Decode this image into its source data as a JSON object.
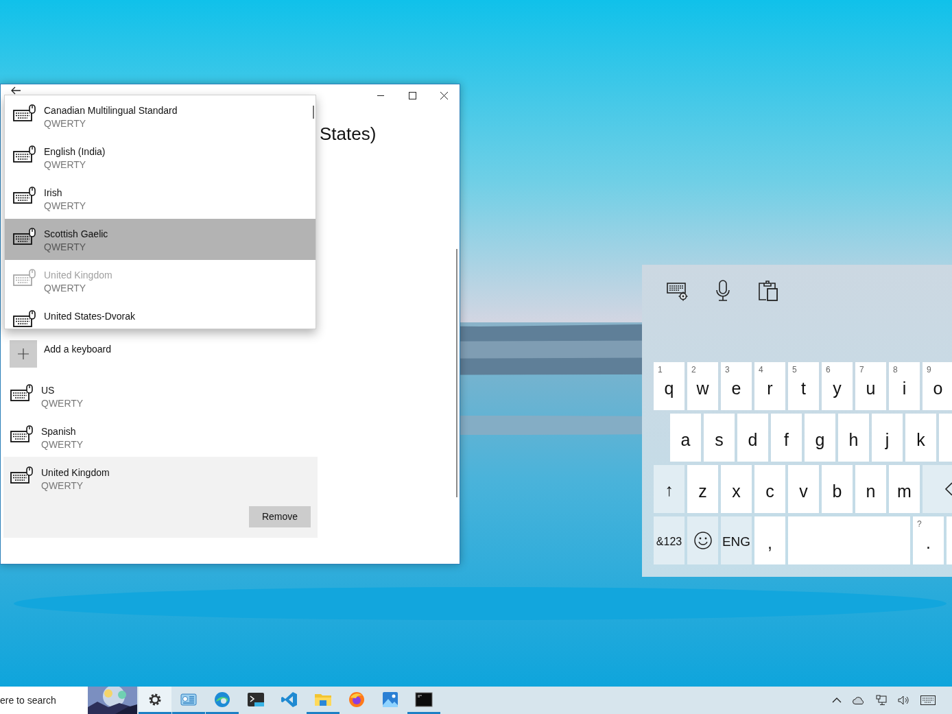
{
  "settings_window": {
    "heading": "States)",
    "dropdown": {
      "items": [
        {
          "name": "Canadian Multilingual Standard",
          "layout": "QWERTY",
          "selected": false,
          "disabled": false
        },
        {
          "name": "English (India)",
          "layout": "QWERTY",
          "selected": false,
          "disabled": false
        },
        {
          "name": "Irish",
          "layout": "QWERTY",
          "selected": false,
          "disabled": false
        },
        {
          "name": "Scottish Gaelic",
          "layout": "QWERTY",
          "selected": true,
          "disabled": false
        },
        {
          "name": "United Kingdom",
          "layout": "QWERTY",
          "selected": false,
          "disabled": true
        },
        {
          "name": "United States-Dvorak",
          "selected": false,
          "disabled": false
        }
      ]
    },
    "add_keyboard": "Add a keyboard",
    "keyboards": [
      {
        "name": "US",
        "layout": "QWERTY",
        "selected": false
      },
      {
        "name": "Spanish",
        "layout": "QWERTY",
        "selected": false
      },
      {
        "name": "United Kingdom",
        "layout": "QWERTY",
        "selected": true
      }
    ],
    "remove_button": "Remove"
  },
  "touch_keyboard": {
    "rows": [
      [
        {
          "kind": "letter",
          "label": "q",
          "hint": "1"
        },
        {
          "kind": "letter",
          "label": "w",
          "hint": "2"
        },
        {
          "kind": "letter",
          "label": "e",
          "hint": "3"
        },
        {
          "kind": "letter",
          "label": "r",
          "hint": "4"
        },
        {
          "kind": "letter",
          "label": "t",
          "hint": "5"
        },
        {
          "kind": "letter",
          "label": "y",
          "hint": "6"
        },
        {
          "kind": "letter",
          "label": "u",
          "hint": "7"
        },
        {
          "kind": "letter",
          "label": "i",
          "hint": "8"
        },
        {
          "kind": "letter",
          "label": "o",
          "hint": "9"
        }
      ],
      [
        {
          "kind": "letter",
          "label": "a"
        },
        {
          "kind": "letter",
          "label": "s"
        },
        {
          "kind": "letter",
          "label": "d"
        },
        {
          "kind": "letter",
          "label": "f"
        },
        {
          "kind": "letter",
          "label": "g"
        },
        {
          "kind": "letter",
          "label": "h"
        },
        {
          "kind": "letter",
          "label": "j"
        },
        {
          "kind": "letter",
          "label": "k"
        },
        {
          "kind": "letter"
        }
      ],
      [
        {
          "kind": "shift",
          "label": "↑"
        },
        {
          "kind": "letter",
          "label": "z"
        },
        {
          "kind": "letter",
          "label": "x"
        },
        {
          "kind": "letter",
          "label": "c"
        },
        {
          "kind": "letter",
          "label": "v"
        },
        {
          "kind": "letter",
          "label": "b"
        },
        {
          "kind": "letter",
          "label": "n"
        },
        {
          "kind": "letter",
          "label": "m"
        },
        {
          "kind": "backspace"
        }
      ],
      [
        {
          "kind": "symbols",
          "label": "&123"
        },
        {
          "kind": "emoji"
        },
        {
          "kind": "language",
          "label": "ENG"
        },
        {
          "kind": "letter",
          "label": ","
        },
        {
          "kind": "space"
        },
        {
          "kind": "letter",
          "label": ".",
          "hint": "?"
        },
        {
          "kind": "letter"
        }
      ]
    ]
  },
  "taskbar": {
    "search_text": "ere to search",
    "apps": [
      {
        "kind": "settings",
        "running": true,
        "selected": true
      },
      {
        "kind": "news",
        "running": true,
        "selected": false
      },
      {
        "kind": "edge",
        "running": true,
        "selected": false
      },
      {
        "kind": "terminal",
        "running": false,
        "selected": false
      },
      {
        "kind": "code",
        "running": false,
        "selected": false
      },
      {
        "kind": "explorer",
        "running": true,
        "selected": false
      },
      {
        "kind": "firefox",
        "running": false,
        "selected": false
      },
      {
        "kind": "photos",
        "running": false,
        "selected": false
      },
      {
        "kind": "cmd",
        "running": true,
        "selected": false
      }
    ]
  }
}
